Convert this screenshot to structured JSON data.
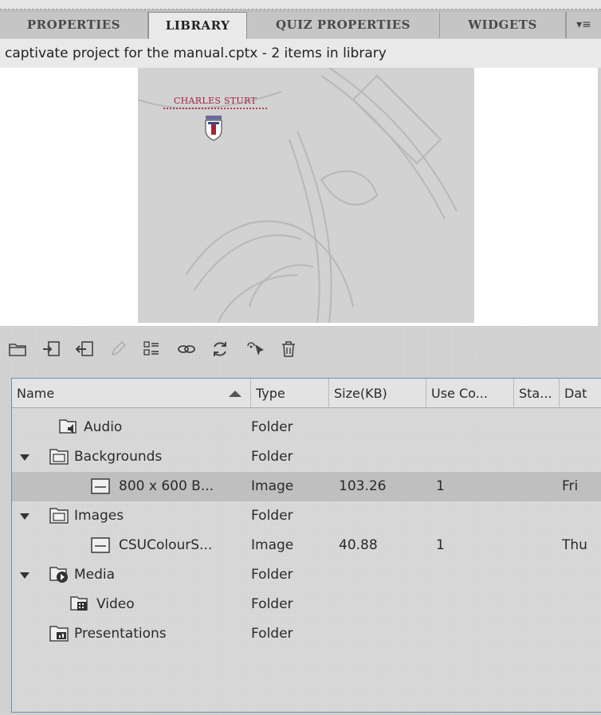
{
  "tabs": [
    {
      "label": "PROPERTIES",
      "active": false
    },
    {
      "label": "LIBRARY",
      "active": true
    },
    {
      "label": "QUIZ PROPERTIES",
      "active": false
    },
    {
      "label": "WIDGETS",
      "active": false
    }
  ],
  "tab_menu_icon": "panel-menu-icon",
  "header": {
    "text": "captivate project for the manual.cptx - 2 items in library"
  },
  "preview": {
    "logo_text": "CHARLES STURT",
    "accent_color": "#a5243a"
  },
  "toolbar": {
    "icons": [
      "new-folder-icon",
      "import-icon",
      "export-icon",
      "edit-icon",
      "properties-icon",
      "usage-icon",
      "update-icon",
      "select-unused-icon",
      "delete-icon"
    ]
  },
  "table": {
    "columns": [
      "Name",
      "Type",
      "Size(KB)",
      "Use Co...",
      "Sta...",
      "Dat"
    ],
    "rows": [
      {
        "name": "Audio",
        "type": "Folder",
        "size": "",
        "use": "",
        "date": "",
        "icon": "audio-folder-icon",
        "expanded": null,
        "selected": false
      },
      {
        "name": "Backgrounds",
        "type": "Folder",
        "size": "",
        "use": "",
        "date": "",
        "icon": "folder-icon",
        "expanded": true,
        "selected": false
      },
      {
        "name": "800 x 600 B...",
        "type": "Image",
        "size": "103.26",
        "use": "1",
        "date": "Fri",
        "icon": "image-icon",
        "expanded": null,
        "selected": true
      },
      {
        "name": "Images",
        "type": "Folder",
        "size": "",
        "use": "",
        "date": "",
        "icon": "folder-icon",
        "expanded": true,
        "selected": false
      },
      {
        "name": "CSUColourS...",
        "type": "Image",
        "size": "40.88",
        "use": "1",
        "date": "Thu",
        "icon": "image-icon",
        "expanded": null,
        "selected": false
      },
      {
        "name": "Media",
        "type": "Folder",
        "size": "",
        "use": "",
        "date": "",
        "icon": "media-folder-icon",
        "expanded": true,
        "selected": false
      },
      {
        "name": "Video",
        "type": "Folder",
        "size": "",
        "use": "",
        "date": "",
        "icon": "video-folder-icon",
        "expanded": null,
        "selected": false
      },
      {
        "name": "Presentations",
        "type": "Folder",
        "size": "",
        "use": "",
        "date": "",
        "icon": "presentation-folder-icon",
        "expanded": null,
        "selected": false
      }
    ]
  }
}
